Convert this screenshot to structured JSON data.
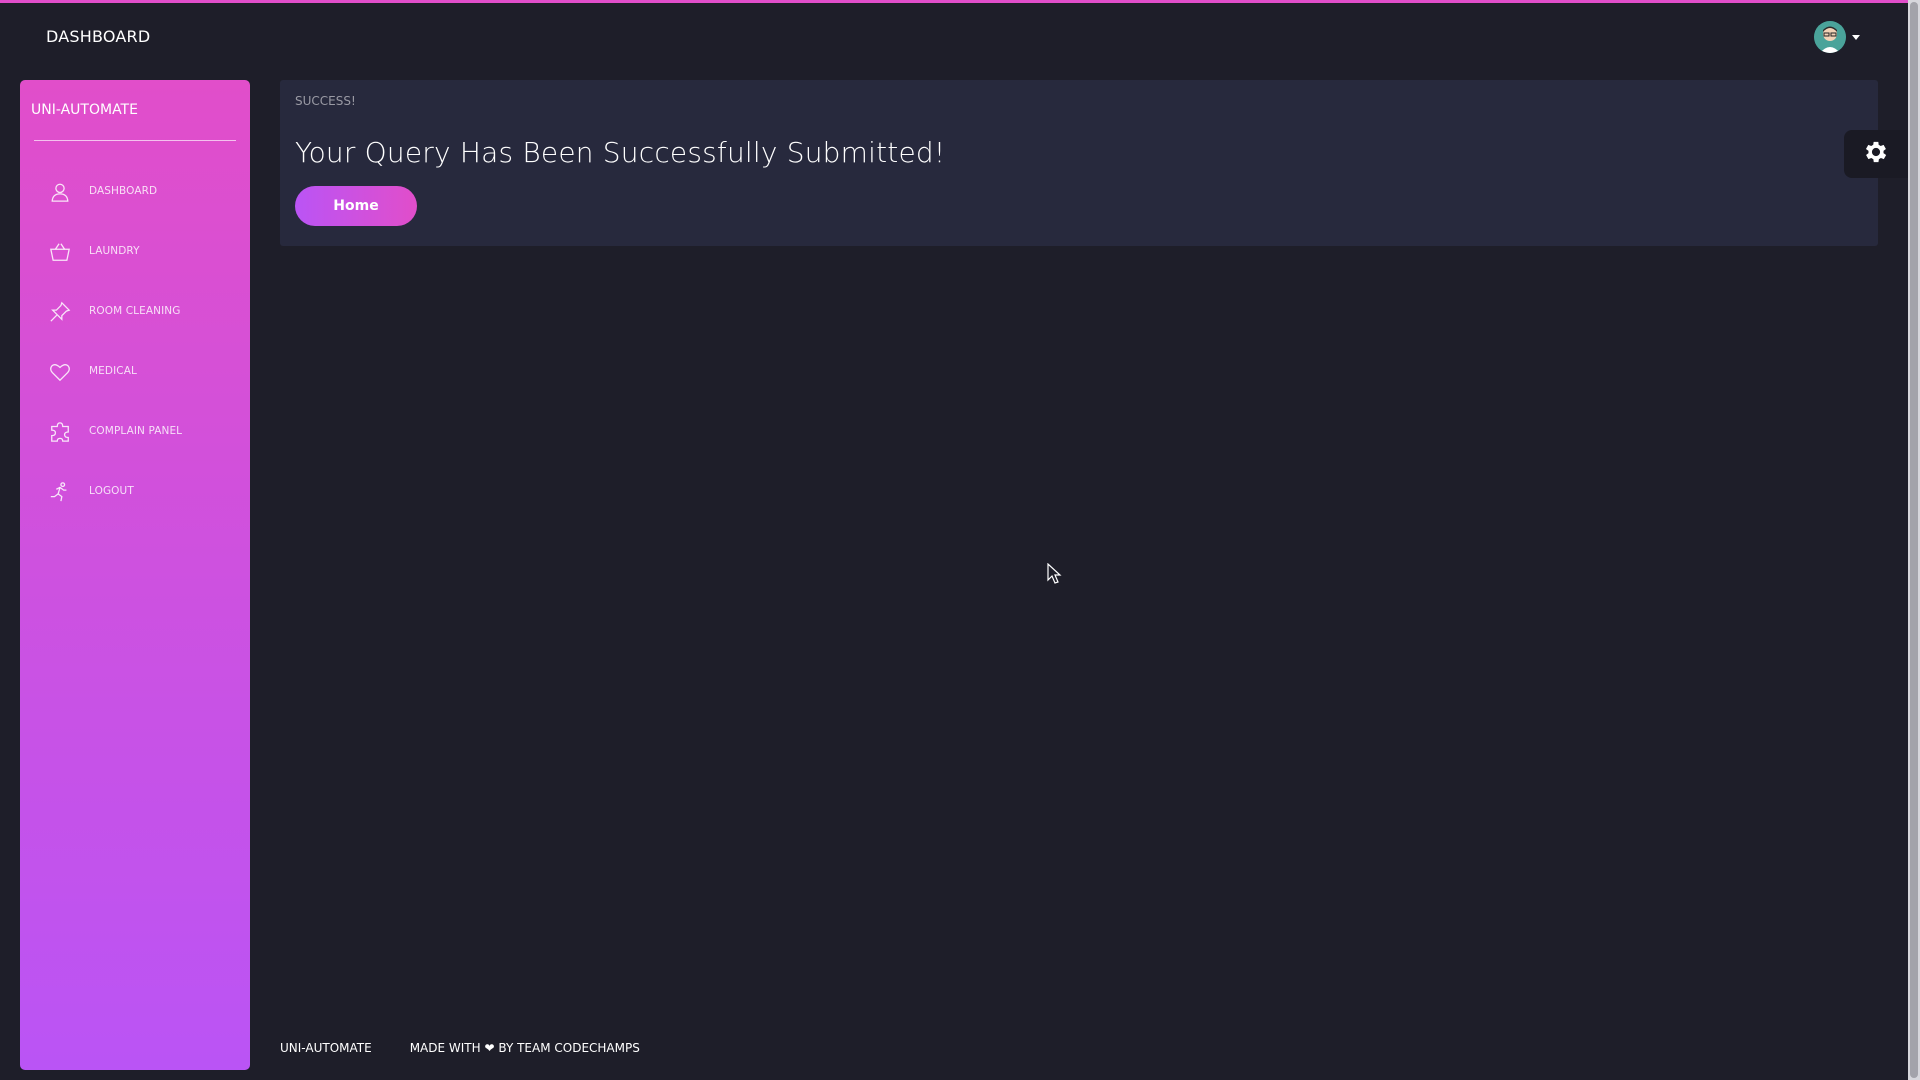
{
  "navbar": {
    "brand": "DASHBOARD",
    "avatar_icon": "user-avatar-icon"
  },
  "sidebar": {
    "brand": "UNI-AUTOMATE",
    "items": [
      {
        "label": "DASHBOARD",
        "icon": "user-icon"
      },
      {
        "label": "LAUNDRY",
        "icon": "basket-icon"
      },
      {
        "label": "ROOM CLEANING",
        "icon": "pin-icon"
      },
      {
        "label": "MEDICAL",
        "icon": "heart-icon"
      },
      {
        "label": "COMPLAIN PANEL",
        "icon": "puzzle-icon"
      },
      {
        "label": "LOGOUT",
        "icon": "runner-icon"
      }
    ]
  },
  "card": {
    "category": "SUCCESS!",
    "title": "Your Query Has Been Successfully Submitted!",
    "button_label": "Home"
  },
  "settings": {
    "icon": "gear-icon"
  },
  "footer": {
    "brand": "UNI-AUTOMATE",
    "made_with_prefix": "MADE WITH",
    "heart": "❤",
    "made_with_suffix": "BY TEAM CODECHAMPS"
  },
  "colors": {
    "accent_pink": "#e14eca",
    "accent_purple": "#ba54f5",
    "background": "#1e1e29",
    "card": "#27293d"
  }
}
